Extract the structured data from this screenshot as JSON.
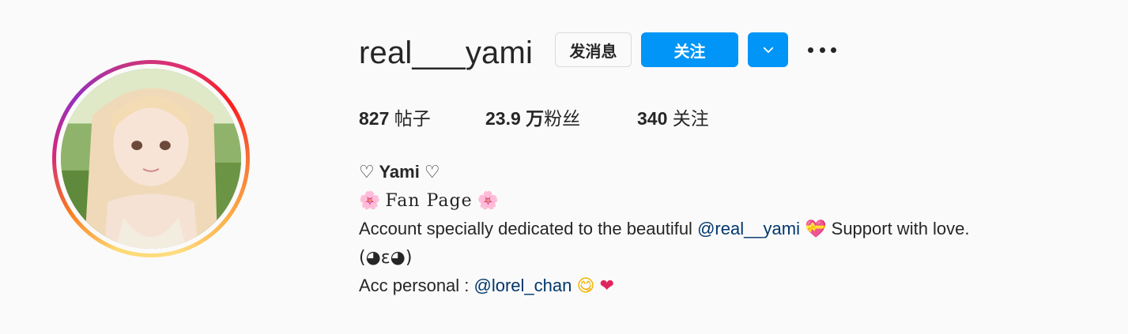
{
  "profile": {
    "username": "real___yami",
    "actions": {
      "message_label": "发消息",
      "follow_label": "关注",
      "dropdown_icon": "chevron-down-icon",
      "more_icon": "more-horizontal-icon"
    },
    "stats": {
      "posts_count": "827",
      "posts_label": "帖子",
      "followers_count": "23.9 万",
      "followers_label": "粉丝",
      "following_count": "340",
      "following_label": "关注"
    },
    "bio": {
      "name": "♡ Yami ♡",
      "fanpage": "Fan Page",
      "line1_prefix": "Account specially dedicated to the beautiful ",
      "line1_mention": "@real__yami",
      "line1_suffix": " Support with love.",
      "line2": "(◕ε◕)",
      "line3_prefix": "Acc personal : ",
      "line3_mention": "@lorel_chan",
      "emoji_flower": "🌸",
      "emoji_heart_ribbon": "💝",
      "emoji_yum": "😋",
      "emoji_heart": "❤"
    }
  },
  "colors": {
    "follow_button": "#0095f6",
    "mention_link": "#00376b",
    "text": "#262626",
    "background": "#fafafa"
  }
}
